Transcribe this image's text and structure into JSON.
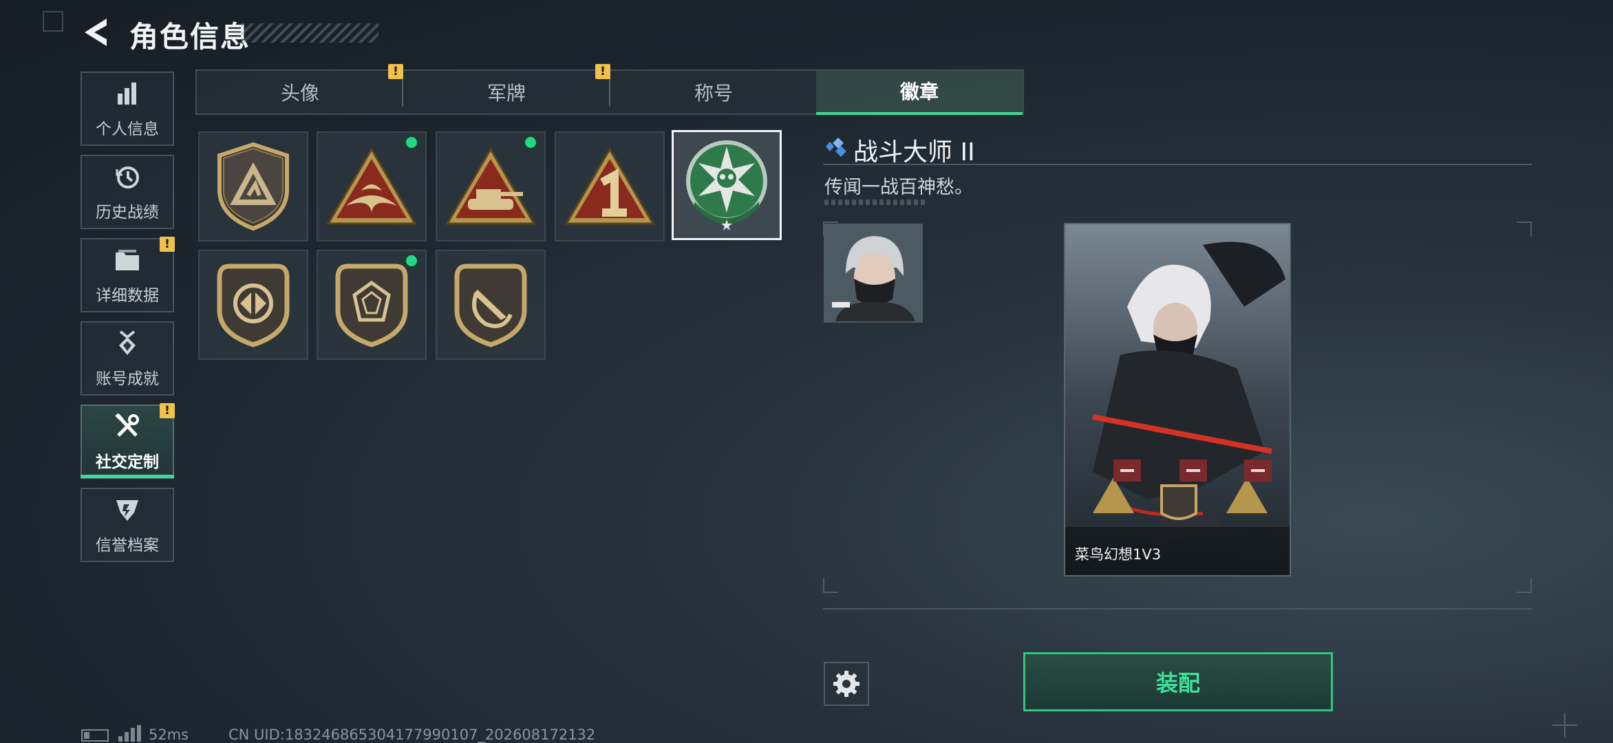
{
  "header": {
    "title": "角色信息"
  },
  "sidebar": {
    "items": [
      {
        "label": "个人信息",
        "icon": "bar-chart-icon",
        "warn": false,
        "active": false
      },
      {
        "label": "历史战绩",
        "icon": "history-clock-icon",
        "warn": false,
        "active": false
      },
      {
        "label": "详细数据",
        "icon": "folder-icon",
        "warn": true,
        "active": false
      },
      {
        "label": "账号成就",
        "icon": "achievement-medal-icon",
        "warn": false,
        "active": false
      },
      {
        "label": "社交定制",
        "icon": "tools-icon",
        "warn": true,
        "active": true
      },
      {
        "label": "信誉档案",
        "icon": "credit-shield-icon",
        "warn": false,
        "active": false
      }
    ],
    "warn_mark": "!"
  },
  "tabs": [
    {
      "label": "头像",
      "warn": true,
      "active": false
    },
    {
      "label": "军牌",
      "warn": true,
      "active": false
    },
    {
      "label": "称号",
      "warn": false,
      "active": false
    },
    {
      "label": "徽章",
      "warn": false,
      "active": true
    }
  ],
  "badges": [
    {
      "name": "mountain-shield-badge",
      "new": false,
      "selected": false
    },
    {
      "name": "bird-triangle-badge",
      "new": true,
      "selected": false
    },
    {
      "name": "tank-triangle-badge",
      "new": true,
      "selected": false
    },
    {
      "name": "number-one-triangle-badge",
      "new": false,
      "selected": false
    },
    {
      "name": "green-star-skull-badge",
      "new": false,
      "selected": true
    },
    {
      "name": "arrows-shield-badge",
      "new": false,
      "selected": false
    },
    {
      "name": "gem-shield-badge",
      "new": true,
      "selected": false
    },
    {
      "name": "knife-shield-badge",
      "new": false,
      "selected": false
    }
  ],
  "detail": {
    "title": "战斗大师 II",
    "description": "传闻一战百神愁。"
  },
  "card": {
    "caption": "菜鸟幻想1V3"
  },
  "actions": {
    "equip_label": "装配"
  },
  "status": {
    "ping": "52ms",
    "uid": "CN UID:1832468653041779901​07_202608172132"
  },
  "colors": {
    "accent": "#3ed89a",
    "warn": "#f0c24a",
    "new_dot": "#25d684"
  }
}
